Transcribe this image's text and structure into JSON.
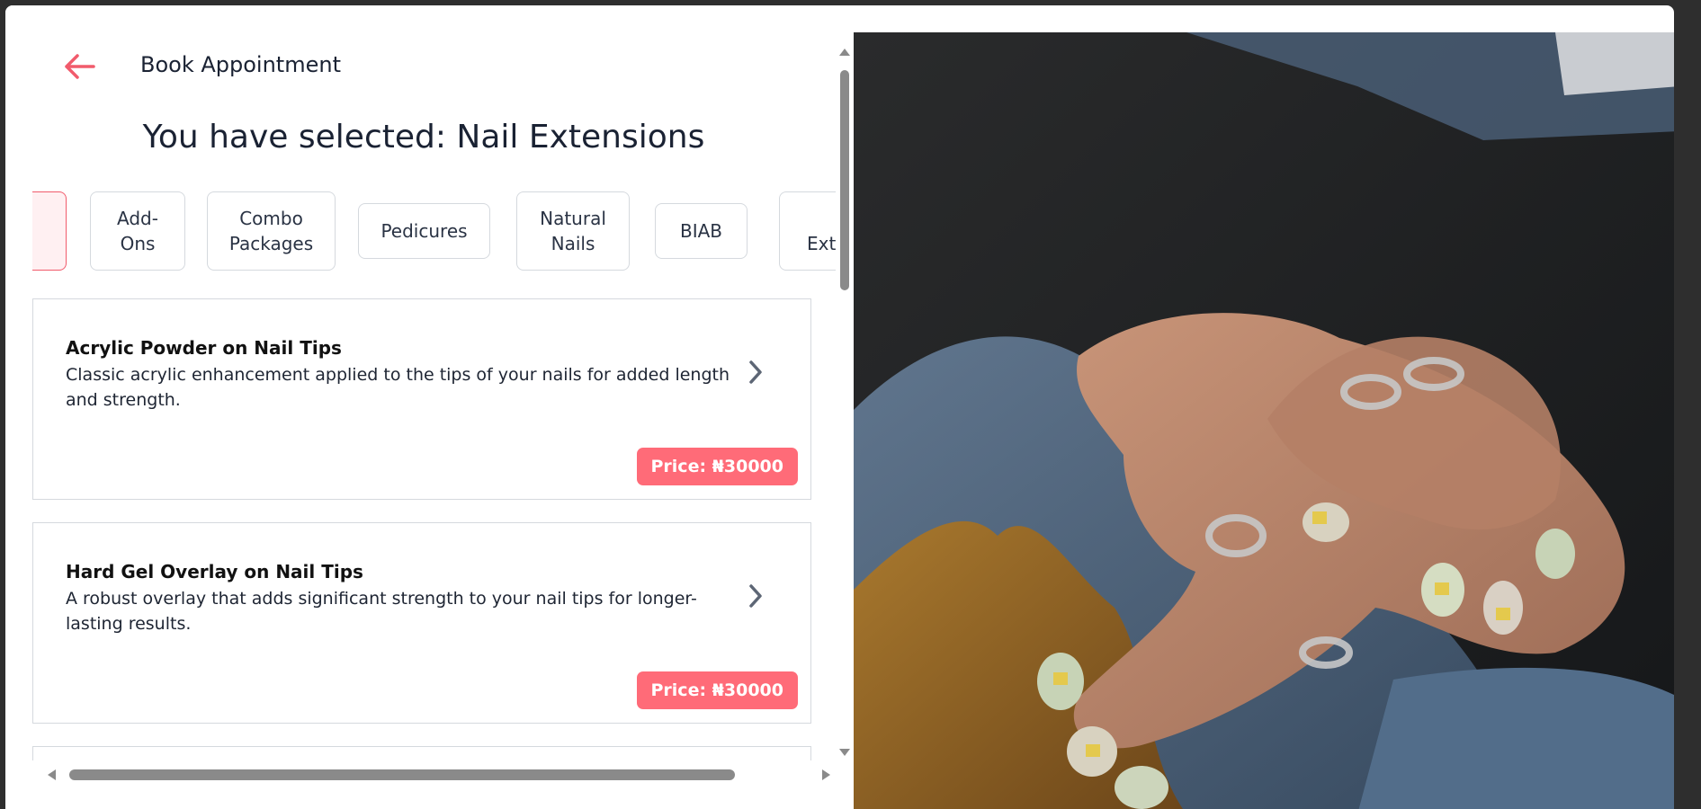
{
  "header": {
    "title": "Book Appointment",
    "selected_prefix": "You have selected: Nail Extensions"
  },
  "tabs": [
    {
      "label": ""
    },
    {
      "label": "Add-Ons"
    },
    {
      "label": "Combo Packages"
    },
    {
      "label": "Pedicures"
    },
    {
      "label": "Natural Nails"
    },
    {
      "label": "BIAB"
    },
    {
      "label": "Exte"
    }
  ],
  "services": [
    {
      "title": "Acrylic Powder on Nail Tips",
      "description": "Classic acrylic enhancement applied to the tips of your nails for added length and strength.",
      "price": "Price: ₦30000"
    },
    {
      "title": "Hard Gel Overlay on Nail Tips",
      "description": "A robust overlay that adds significant strength to your nail tips for longer-lasting results.",
      "price": "Price: ₦30000"
    }
  ],
  "colors": {
    "accent": "#ff6b78",
    "back_arrow": "#f15b6c",
    "text_dark": "#1a2233"
  },
  "icons": {
    "back": "arrow-left-icon",
    "chevron": "chevron-right-icon"
  }
}
